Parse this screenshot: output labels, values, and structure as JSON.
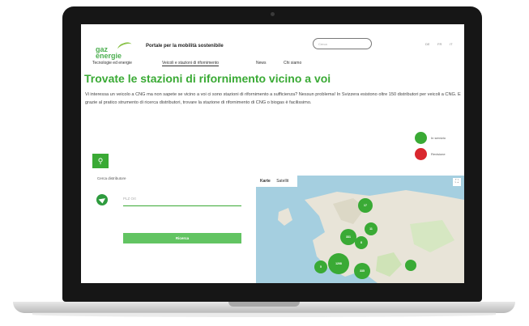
{
  "header": {
    "logo_text": "gaz energie",
    "tagline": "Portale per la mobilità sostenibile",
    "search_placeholder": "Cerca",
    "languages": [
      "DE",
      "FR",
      "IT"
    ]
  },
  "nav": {
    "items": [
      {
        "label": "Tecnologie ed energie",
        "active": false
      },
      {
        "label": "Veicoli e stazioni di rifornimento",
        "active": true
      },
      {
        "label": "News",
        "active": false
      },
      {
        "label": "Chi siamo",
        "active": false
      }
    ]
  },
  "main": {
    "headline": "Trovate le stazioni di rifornimento vicino a voi",
    "intro": "Vi interessa un veicolo a CNG ma non sapete se vicino a voi ci sono stazioni di rifornimento a sufficienza? Nessun problema! In Svizzera esistono oltre 150 distributori per veicoli a CNG. E grazie al pratico strumento di ricerca distributori, trovare la stazione di rifornimento di CNG o biogas è facilissimo."
  },
  "legend": {
    "items": [
      {
        "label": "In servizio",
        "color": "#3aaa35"
      },
      {
        "label": "Revisione",
        "color": "#d9272e"
      }
    ]
  },
  "finder": {
    "search_icon": "search-icon",
    "label": "Cerca distributore",
    "location_icon": "location-arrow-icon",
    "input_placeholder": "PLZ Ort",
    "submit_label": "Ricerca"
  },
  "map": {
    "tabs": [
      "Karte",
      "Satellit"
    ],
    "fullscreen_icon": "fullscreen-icon",
    "clusters": [
      "17",
      "11",
      "8",
      "331",
      "5",
      "1208",
      "335"
    ]
  },
  "colors": {
    "accent": "#3aaa35",
    "alert": "#d9272e"
  }
}
